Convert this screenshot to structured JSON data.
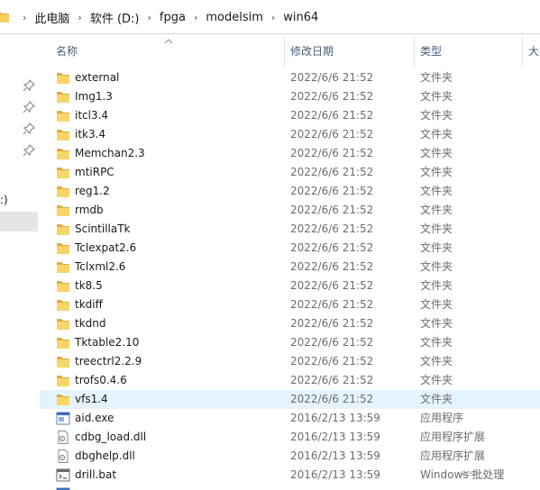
{
  "breadcrumb": [
    "此电脑",
    "软件 (D:)",
    "fpga",
    "modelsim",
    "win64"
  ],
  "nav": {
    "drive_label": ":)"
  },
  "columns": {
    "name": "名称",
    "date": "修改日期",
    "type": "类型",
    "size": "大"
  },
  "files": [
    {
      "name": "external",
      "date": "2022/6/6 21:52",
      "type": "文件夹",
      "icon": "folder-icon"
    },
    {
      "name": "Img1.3",
      "date": "2022/6/6 21:52",
      "type": "文件夹",
      "icon": "folder-icon"
    },
    {
      "name": "itcl3.4",
      "date": "2022/6/6 21:52",
      "type": "文件夹",
      "icon": "folder-icon"
    },
    {
      "name": "itk3.4",
      "date": "2022/6/6 21:52",
      "type": "文件夹",
      "icon": "folder-icon"
    },
    {
      "name": "Memchan2.3",
      "date": "2022/6/6 21:52",
      "type": "文件夹",
      "icon": "folder-icon"
    },
    {
      "name": "mtiRPC",
      "date": "2022/6/6 21:52",
      "type": "文件夹",
      "icon": "folder-icon"
    },
    {
      "name": "reg1.2",
      "date": "2022/6/6 21:52",
      "type": "文件夹",
      "icon": "folder-icon"
    },
    {
      "name": "rmdb",
      "date": "2022/6/6 21:52",
      "type": "文件夹",
      "icon": "folder-icon"
    },
    {
      "name": "ScintillaTk",
      "date": "2022/6/6 21:52",
      "type": "文件夹",
      "icon": "folder-icon"
    },
    {
      "name": "Tclexpat2.6",
      "date": "2022/6/6 21:52",
      "type": "文件夹",
      "icon": "folder-icon"
    },
    {
      "name": "Tclxml2.6",
      "date": "2022/6/6 21:52",
      "type": "文件夹",
      "icon": "folder-icon"
    },
    {
      "name": "tk8.5",
      "date": "2022/6/6 21:52",
      "type": "文件夹",
      "icon": "folder-icon"
    },
    {
      "name": "tkdiff",
      "date": "2022/6/6 21:52",
      "type": "文件夹",
      "icon": "folder-icon"
    },
    {
      "name": "tkdnd",
      "date": "2022/6/6 21:52",
      "type": "文件夹",
      "icon": "folder-icon"
    },
    {
      "name": "Tktable2.10",
      "date": "2022/6/6 21:52",
      "type": "文件夹",
      "icon": "folder-icon"
    },
    {
      "name": "treectrl2.2.9",
      "date": "2022/6/6 21:52",
      "type": "文件夹",
      "icon": "folder-icon"
    },
    {
      "name": "trofs0.4.6",
      "date": "2022/6/6 21:52",
      "type": "文件夹",
      "icon": "folder-icon"
    },
    {
      "name": "vfs1.4",
      "date": "2022/6/6 21:52",
      "type": "文件夹",
      "icon": "folder-icon",
      "selected": true
    },
    {
      "name": "aid.exe",
      "date": "2016/2/13 13:59",
      "type": "应用程序",
      "icon": "exe-icon"
    },
    {
      "name": "cdbg_load.dll",
      "date": "2016/2/13 13:59",
      "type": "应用程序扩展",
      "icon": "dll-icon"
    },
    {
      "name": "dbghelp.dll",
      "date": "2016/2/13 13:59",
      "type": "应用程序扩展",
      "icon": "dll-icon"
    },
    {
      "name": "drill.bat",
      "date": "2016/2/13 13:59",
      "type": "Windows 批处理",
      "icon": "bat-icon"
    },
    {
      "name": "",
      "date": "",
      "type": "",
      "icon": "exe-icon"
    }
  ],
  "watermark": "zeni",
  "colors": {
    "selected_row": "#e5f3ff",
    "folder": "#f5c542",
    "header_text": "#4c607a"
  }
}
